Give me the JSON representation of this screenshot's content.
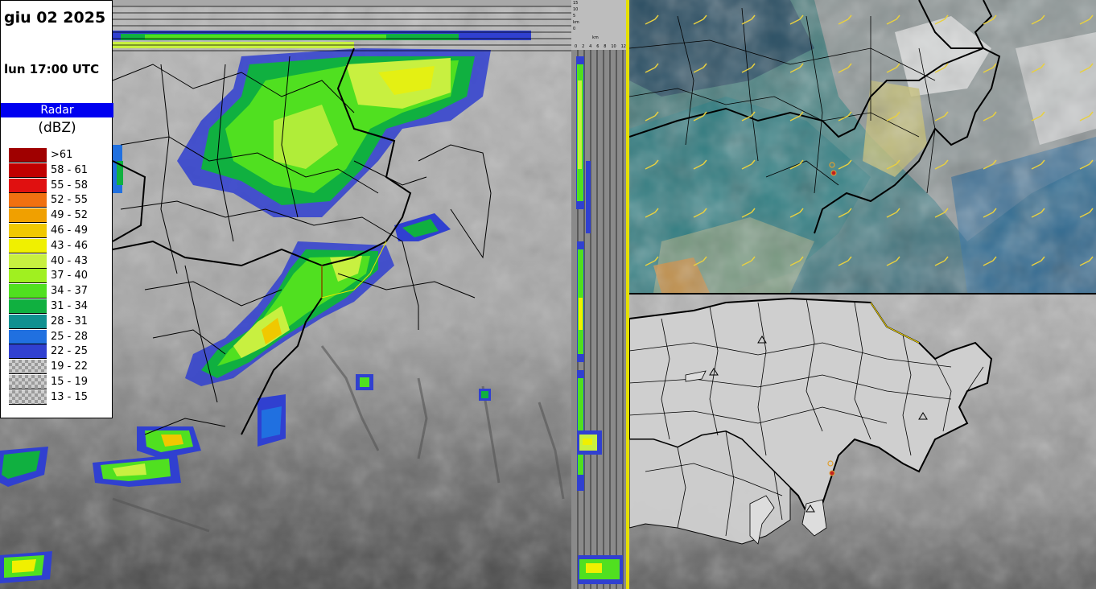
{
  "header": {
    "date": "giu 02 2025",
    "time": "lun 17:00 UTC"
  },
  "legend": {
    "title": "Radar",
    "unit": "(dBZ)",
    "classes": [
      {
        "label": ">61",
        "color": "#a00000"
      },
      {
        "label": "58 - 61",
        "color": "#c00000"
      },
      {
        "label": "55 - 58",
        "color": "#e01010"
      },
      {
        "label": "52 - 55",
        "color": "#f07010"
      },
      {
        "label": "49 - 52",
        "color": "#f0a000"
      },
      {
        "label": "46 - 49",
        "color": "#f0c800"
      },
      {
        "label": "43 - 46",
        "color": "#f0f000"
      },
      {
        "label": "40 - 43",
        "color": "#c8f040"
      },
      {
        "label": "37 - 40",
        "color": "#a0f020"
      },
      {
        "label": "34 - 37",
        "color": "#50e020"
      },
      {
        "label": "31 - 34",
        "color": "#10b040"
      },
      {
        "label": "28 - 31",
        "color": "#109090"
      },
      {
        "label": "25 - 28",
        "color": "#2070e0"
      },
      {
        "label": "22 - 25",
        "color": "#3040d0"
      },
      {
        "label": "19 - 22",
        "color": "checker"
      },
      {
        "label": "15 - 19",
        "color": "checker"
      },
      {
        "label": "13 - 15",
        "color": "checker"
      }
    ]
  },
  "profile": {
    "top_ticks": [
      "15",
      "10",
      "5",
      "km",
      "0"
    ],
    "km_label": "km",
    "x_ticks": [
      "0",
      "2",
      "4",
      "6",
      "8",
      "10",
      "12"
    ]
  }
}
